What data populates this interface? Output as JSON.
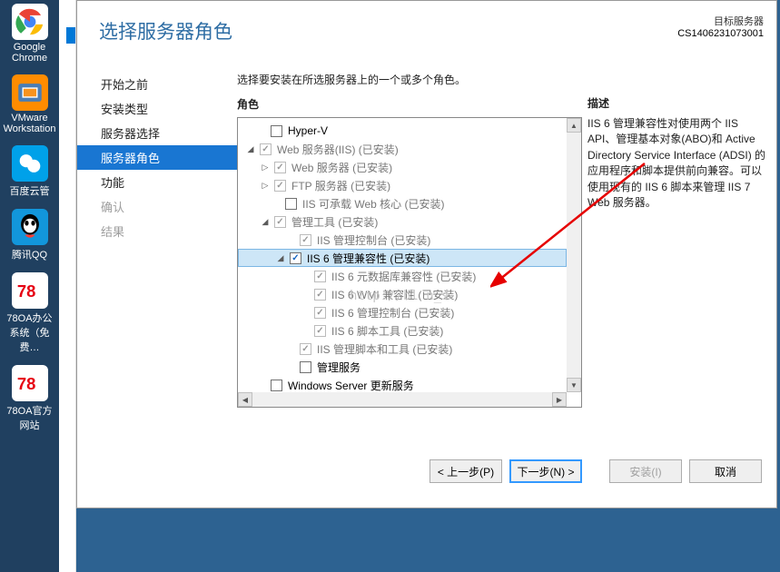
{
  "desktop": {
    "icons": [
      {
        "label": "Google Chrome",
        "bg": "#fff"
      },
      {
        "label": "VMware Workstation",
        "bg": "#ff8c00"
      },
      {
        "label": "百度云管",
        "bg": "#00a1e9"
      },
      {
        "label": "腾讯QQ",
        "bg": "#1296db"
      },
      {
        "label": "78OA办公系统（免费…",
        "bg": "#ffffff"
      },
      {
        "label": "78OA官方网站",
        "bg": "#ffffff"
      }
    ]
  },
  "wizard": {
    "title": "选择服务器角色",
    "target_label": "目标服务器",
    "target_value": "CS1406231073001",
    "nav": [
      {
        "label": "开始之前",
        "state": ""
      },
      {
        "label": "安装类型",
        "state": ""
      },
      {
        "label": "服务器选择",
        "state": ""
      },
      {
        "label": "服务器角色",
        "state": "sel"
      },
      {
        "label": "功能",
        "state": ""
      },
      {
        "label": "确认",
        "state": "dis"
      },
      {
        "label": "结果",
        "state": "dis"
      }
    ],
    "intro": "选择要安装在所选服务器上的一个或多个角色。",
    "roles_head": "角色",
    "desc_head": "描述",
    "desc_body": "IIS 6 管理兼容性对使用两个 IIS API、管理基本对象(ABO)和 Active Directory Service Interface (ADSI) 的应用程序和脚本提供前向兼容。可以使用现有的 IIS 6 脚本来管理 IIS 7 Web 服务器。",
    "tree": [
      {
        "ind": 20,
        "exp": "",
        "cb": "unchecked",
        "label": "Hyper-V",
        "cls": ""
      },
      {
        "ind": 8,
        "exp": "◢",
        "cb": "checked-grey",
        "label": "Web 服务器(IIS) (已安装)",
        "cls": "grey"
      },
      {
        "ind": 24,
        "exp": "▷",
        "cb": "checked-grey",
        "label": "Web 服务器 (已安装)",
        "cls": "grey"
      },
      {
        "ind": 24,
        "exp": "▷",
        "cb": "checked-grey",
        "label": "FTP 服务器 (已安装)",
        "cls": "grey"
      },
      {
        "ind": 36,
        "exp": "",
        "cb": "unchecked",
        "label": "IIS 可承载 Web 核心 (已安装)",
        "cls": "grey"
      },
      {
        "ind": 24,
        "exp": "◢",
        "cb": "checked-grey",
        "label": "管理工具 (已安装)",
        "cls": "grey"
      },
      {
        "ind": 52,
        "exp": "",
        "cb": "checked-grey",
        "label": "IIS 管理控制台 (已安装)",
        "cls": "grey"
      },
      {
        "ind": 40,
        "exp": "◢",
        "cb": "checked",
        "label": "IIS 6 管理兼容性 (已安装)",
        "cls": "sel"
      },
      {
        "ind": 68,
        "exp": "",
        "cb": "checked-grey",
        "label": "IIS 6 元数据库兼容性 (已安装)",
        "cls": "grey"
      },
      {
        "ind": 68,
        "exp": "",
        "cb": "checked-grey",
        "label": "IIS 6 WMI 兼容性 (已安装)",
        "cls": "grey"
      },
      {
        "ind": 68,
        "exp": "",
        "cb": "checked-grey",
        "label": "IIS 6 管理控制台 (已安装)",
        "cls": "grey"
      },
      {
        "ind": 68,
        "exp": "",
        "cb": "checked-grey",
        "label": "IIS 6 脚本工具 (已安装)",
        "cls": "grey"
      },
      {
        "ind": 52,
        "exp": "",
        "cb": "checked-grey",
        "label": "IIS 管理脚本和工具 (已安装)",
        "cls": "grey"
      },
      {
        "ind": 52,
        "exp": "",
        "cb": "unchecked",
        "label": "管理服务",
        "cls": ""
      },
      {
        "ind": 20,
        "exp": "",
        "cb": "unchecked",
        "label": "Windows Server 更新服务",
        "cls": ""
      }
    ],
    "buttons": {
      "prev": "< 上一步(P)",
      "next": "下一步(N) >",
      "install": "安装(I)",
      "cancel": "取消"
    },
    "watermark": "http://bl            n_s"
  }
}
